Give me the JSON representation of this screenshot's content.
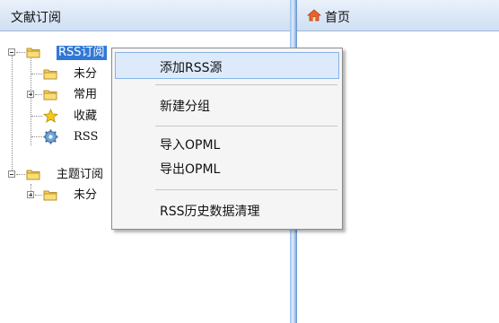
{
  "left_panel": {
    "title": "文献订阅"
  },
  "right_panel": {
    "tab_title": "首页"
  },
  "tree": {
    "rss_root": "RSS订阅",
    "uncategorized": "未分",
    "common": "常用",
    "favorites": "收藏",
    "rss_child": "RSS",
    "topic_root": "主题订阅",
    "topic_uncategorized": "未分"
  },
  "context_menu": {
    "add_rss_source": "添加RSS源",
    "new_group": "新建分组",
    "import_opml": "导入OPML",
    "export_opml": "导出OPML",
    "clear_history": "RSS历史数据清理"
  },
  "colors": {
    "selection": "#3178d6",
    "menu_highlight": "#dceafb",
    "header_gradient_top": "#eaf1fb",
    "splitter": "#5c8fd0"
  }
}
